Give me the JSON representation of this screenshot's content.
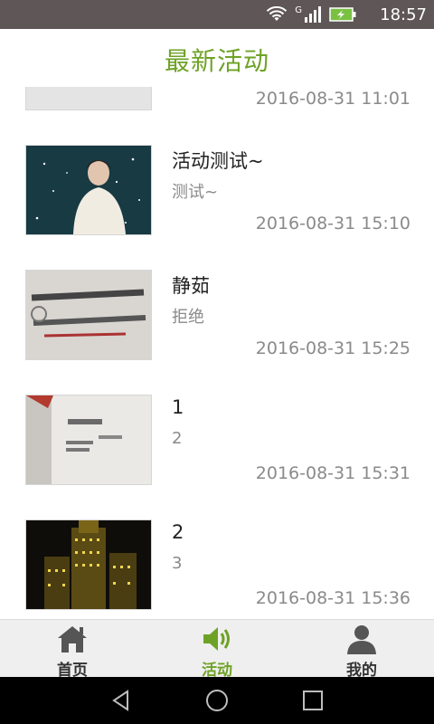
{
  "status_bar": {
    "time": "18:57",
    "signal_label": "G",
    "icons": [
      "wifi-icon",
      "signal-icon",
      "battery-charging-icon"
    ],
    "background": "#5f5658"
  },
  "header": {
    "title": "最新活动",
    "title_color": "#6ea226"
  },
  "activities": [
    {
      "title": "",
      "subtitle": "",
      "time": "2016-08-31 11:01"
    },
    {
      "title": "活动测试~",
      "subtitle": "测试~",
      "time": "2016-08-31 15:10"
    },
    {
      "title": "静茹",
      "subtitle": "拒绝",
      "time": "2016-08-31 15:25"
    },
    {
      "title": "1",
      "subtitle": "2",
      "time": "2016-08-31 15:31"
    },
    {
      "title": "2",
      "subtitle": "3",
      "time": "2016-08-31 15:36"
    }
  ],
  "bottom_nav": {
    "tabs": [
      {
        "label": "首页",
        "icon": "home-icon",
        "active": false
      },
      {
        "label": "活动",
        "icon": "speaker-icon",
        "active": true
      },
      {
        "label": "我的",
        "icon": "user-icon",
        "active": false
      }
    ],
    "active_color": "#6ea226"
  },
  "system_nav": {
    "buttons": [
      "back-icon",
      "home-circle-icon",
      "recents-icon"
    ]
  }
}
